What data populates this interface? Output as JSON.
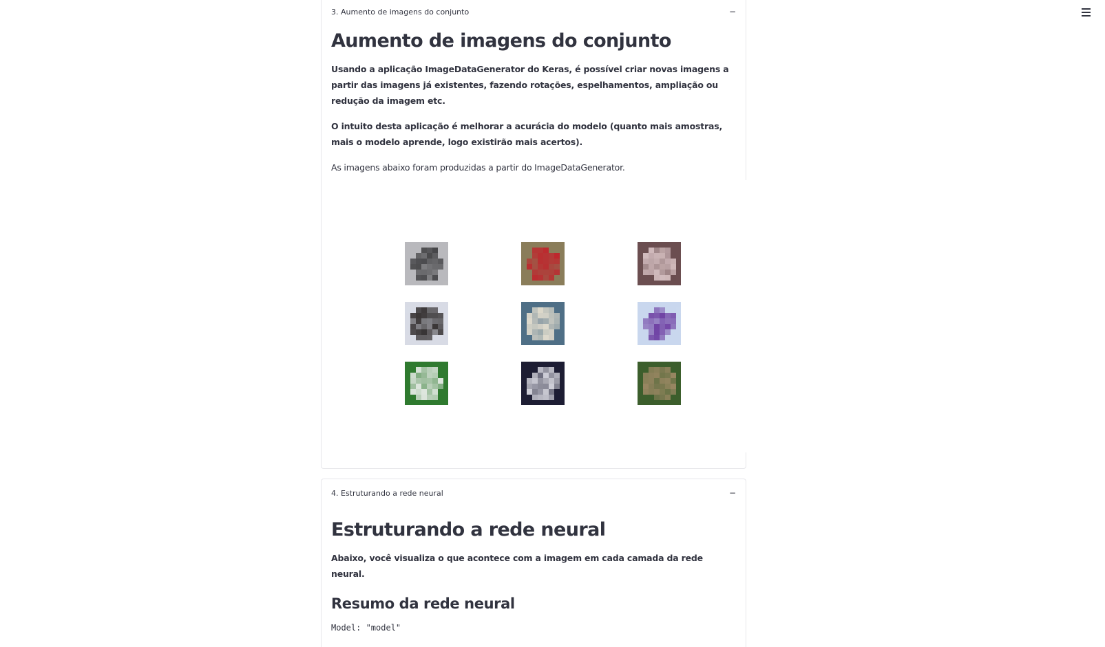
{
  "section3": {
    "header": "3. Aumento de imagens do conjunto",
    "collapse_symbol": "−",
    "title": "Aumento de imagens do conjunto",
    "para1": "Usando a aplicação ImageDataGenerator do Keras, é possível criar novas imagens a partir das imagens já existentes, fazendo rotações, espelhamentos, ampliação ou redução da imagem etc.",
    "para2": "O intuito desta aplicação é melhorar a acurácia do modelo (quanto mais amostras, mais o modelo aprende, logo existirão mais acertos).",
    "para3": "As imagens abaixo foram produzidas a partir do ImageDataGenerator.",
    "images": [
      {
        "name": "cat-grey",
        "bg": "#b9b9bd",
        "fg": "#3a3a3c"
      },
      {
        "name": "red-truck",
        "bg": "#8a7d5a",
        "fg": "#c2202a"
      },
      {
        "name": "red-object",
        "bg": "#6b4e50",
        "fg": "#d8c2c4"
      },
      {
        "name": "dog-black-white",
        "bg": "#d8dbe5",
        "fg": "#2e2a2a"
      },
      {
        "name": "boat",
        "bg": "#4f6f86",
        "fg": "#e7e0d0"
      },
      {
        "name": "airplane",
        "bg": "#c9d7ee",
        "fg": "#6b3aa0"
      },
      {
        "name": "white-dog-grass",
        "bg": "#2f7a2f",
        "fg": "#e8ece8"
      },
      {
        "name": "dark-animal",
        "bg": "#1d1d33",
        "fg": "#d8d8e0"
      },
      {
        "name": "deer-green",
        "bg": "#3c5e2c",
        "fg": "#a08a66"
      }
    ]
  },
  "section4": {
    "header": "4. Estruturando a rede neural",
    "collapse_symbol": "−",
    "title": "Estruturando a rede neural",
    "para1": "Abaixo, você visualiza o que acontece com a imagem em cada camada da rede neural.",
    "subtitle": "Resumo da rede neural",
    "code_line": "Model: \"model\""
  }
}
